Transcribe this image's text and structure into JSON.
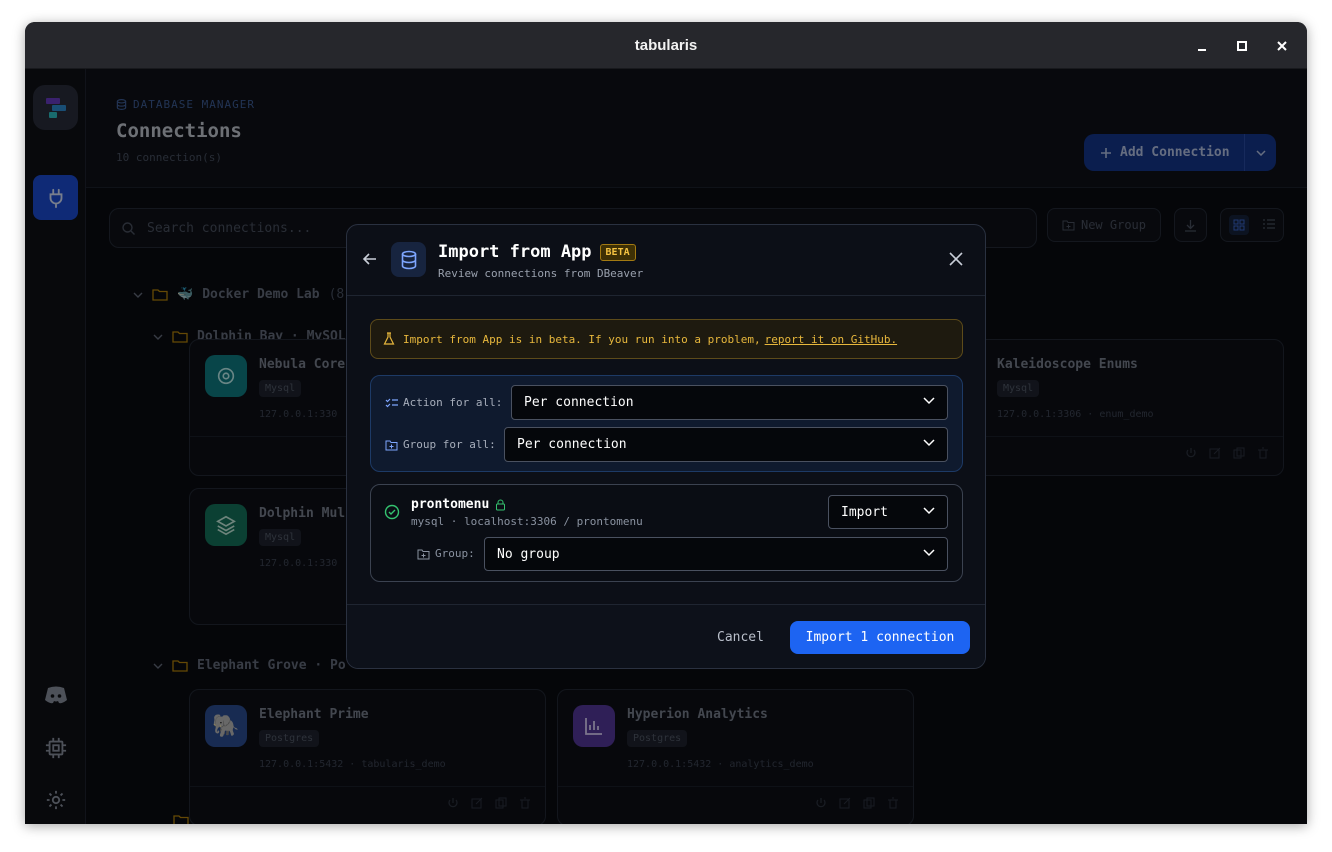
{
  "window": {
    "title": "tabularis"
  },
  "header": {
    "eyebrow": "DATABASE MANAGER",
    "title": "Connections",
    "count": "10 connection(s)",
    "add_button": "Add Connection"
  },
  "toolbar": {
    "search_placeholder": "Search connections...",
    "new_group": "New Group"
  },
  "tree": {
    "group1": {
      "label": "Docker Demo Lab",
      "count": "(8)"
    },
    "sub1": {
      "label": "Dolphin Bay · MySQL"
    },
    "sub2": {
      "label": "Elephant Grove · Po"
    },
    "sub3": {
      "label": ""
    }
  },
  "cards": [
    {
      "name": "Nebula Core",
      "badge": "Mysql",
      "addr": "127.0.0.1:330",
      "icon": "dolphin-ring-icon",
      "color": "#0f7f86"
    },
    {
      "name": "Kaleidoscope Enums",
      "badge": "Mysql",
      "addr": "127.0.0.1:3306 · enum_demo",
      "icon": "none"
    },
    {
      "name": "Dolphin Mul",
      "badge": "Mysql",
      "addr": "127.0.0.1:330",
      "icon": "layers-icon",
      "color": "#15765d"
    },
    {
      "name": "Elephant Prime",
      "badge": "Postgres",
      "addr": "127.0.0.1:5432 · tabularis_demo",
      "icon": "elephant-icon",
      "color": "#2c4f96"
    },
    {
      "name": "Hyperion Analytics",
      "badge": "Postgres",
      "addr": "127.0.0.1:5432 · analytics_demo",
      "icon": "bar-chart-icon",
      "color": "#563a9e"
    }
  ],
  "modal": {
    "title": "Import from App",
    "beta": "BETA",
    "subtitle": "Review connections from DBeaver",
    "notice_text": "Import from App is in beta. If you run into a problem,",
    "notice_link": "report it on GitHub.",
    "action_label": "Action for all:",
    "action_value": "Per connection",
    "group_label": "Group for all:",
    "group_value": "Per connection",
    "connection": {
      "name": "prontomenu",
      "meta": "mysql · localhost:3306 / prontomenu",
      "action": "Import",
      "group_label": "Group:",
      "group_value": "No group"
    },
    "cancel": "Cancel",
    "import_button": "Import 1 connection"
  }
}
